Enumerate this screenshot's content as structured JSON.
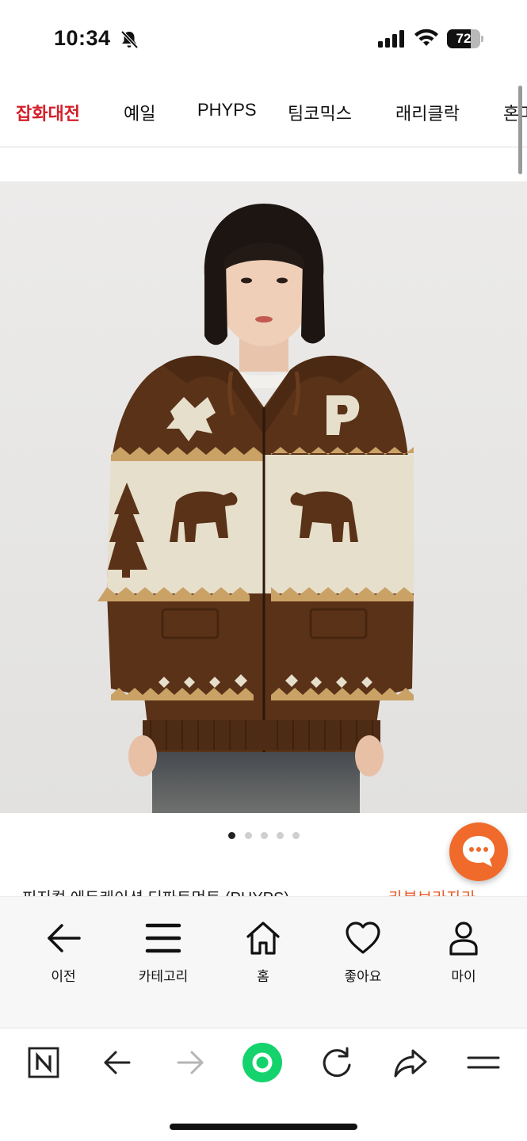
{
  "status_bar": {
    "time": "10:34",
    "battery": "72",
    "battery_level": 0.72
  },
  "categories": [
    {
      "label": "잡화대전",
      "active": true
    },
    {
      "label": "예일"
    },
    {
      "label": "PHYPS"
    },
    {
      "label": "팀코믹스"
    },
    {
      "label": "래리클락"
    },
    {
      "label": "혼마"
    }
  ],
  "carousel": {
    "count": 5,
    "active_index": 0
  },
  "product_title_partial": "피지컬 에듀케이션 디파트먼트 (PHYPS)",
  "product_side_partial": "카본브라자라",
  "bottom_nav": {
    "back": "이전",
    "category": "카테고리",
    "home": "홈",
    "like": "좋아요",
    "my": "마이"
  },
  "icons": {
    "back": "arrow-left-icon",
    "category": "menu-icon",
    "home": "home-icon",
    "like": "heart-icon",
    "my": "person-icon",
    "chat": "chat-bubble-icon",
    "naver": "naver-n-icon",
    "reload": "reload-icon",
    "share": "share-icon",
    "more": "more-menu-icon"
  },
  "colors": {
    "accent_red": "#d41f2a",
    "chat_orange": "#ef6a2b",
    "green_button": "#14d36c",
    "sweater_brown": "#5a3218",
    "sweater_cream": "#e6dfcb"
  }
}
